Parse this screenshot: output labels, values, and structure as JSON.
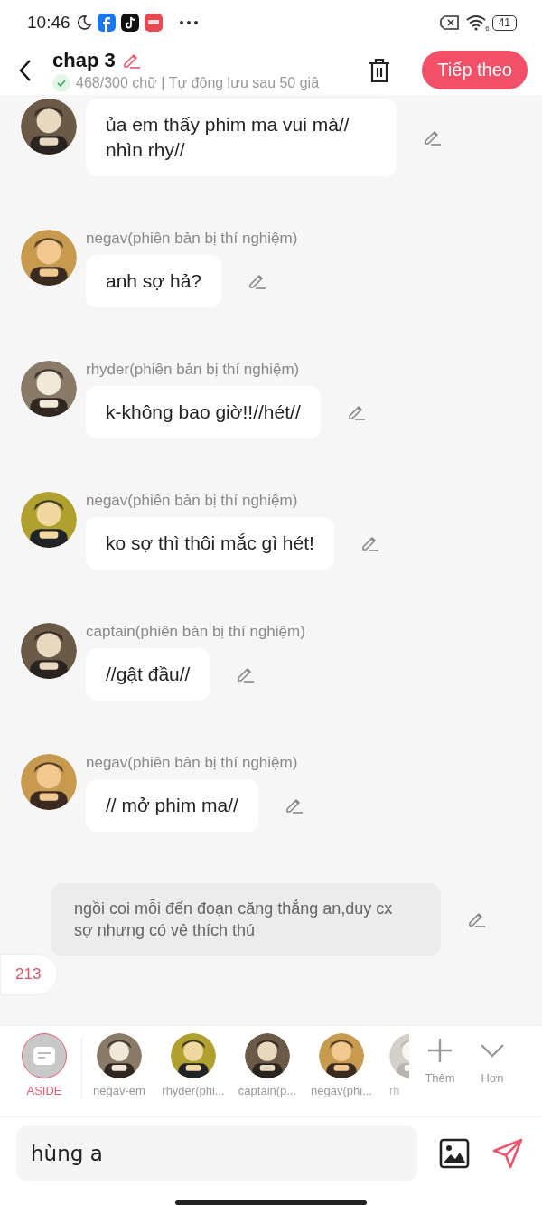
{
  "status_bar": {
    "time": "10:46",
    "battery": "41",
    "wifi_badge": "6"
  },
  "header": {
    "title": "chap 3",
    "subtitle": "468/300 chữ | Tự động lưu sau 50 giâ",
    "saved": true,
    "next_button": "Tiếp theo"
  },
  "messages": [
    {
      "kind": "dialogue",
      "text": "ủa em thấy phim ma vui mà// nhìn rhy//"
    },
    {
      "kind": "dialogue",
      "name": "negav(phiên bản bị thí nghiệm)",
      "text": "anh sợ hả?"
    },
    {
      "kind": "dialogue",
      "name": "rhyder(phiên bản bị thí nghiệm)",
      "text": "k-không bao giờ!!//hét//"
    },
    {
      "kind": "dialogue",
      "name": "negav(phiên bản bị thí nghiệm)",
      "text": "ko sợ thì thôi mắc gì hét!"
    },
    {
      "kind": "dialogue",
      "name": "captain(phiên bản bị thí nghiệm)",
      "text": "//gật đầu//"
    },
    {
      "kind": "dialogue",
      "name": "negav(phiên bản bị thí nghiệm)",
      "text": "// mở phim ma//"
    },
    {
      "kind": "aside",
      "text": "ngồi coi mỗi đến đoạn căng thẳng an,duy cx sợ nhưng có vẻ thích thú"
    }
  ],
  "counter": "213",
  "characters": [
    {
      "kind": "aside",
      "label": "ASIDE",
      "selected": true
    },
    {
      "kind": "character",
      "label": "negav-em",
      "selected": false
    },
    {
      "kind": "character",
      "label": "rhyder(phi...",
      "selected": false
    },
    {
      "kind": "character",
      "label": "captain(p...",
      "selected": false
    },
    {
      "kind": "character",
      "label": "negav(phi...",
      "selected": false
    },
    {
      "kind": "character",
      "label": "rh",
      "selected": false
    }
  ],
  "add_label": "Thêm",
  "more_label": "Hơn",
  "input": {
    "value": "hùng a"
  }
}
